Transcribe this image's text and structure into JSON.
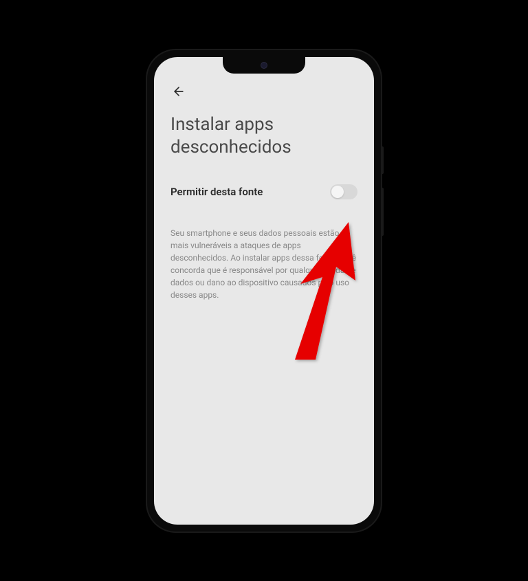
{
  "header": {
    "title": "Instalar apps desconhecidos"
  },
  "setting": {
    "label": "Permitir desta fonte",
    "toggle_state": "off"
  },
  "description": {
    "text": "Seu smartphone e seus dados pessoais estão mais vulneráveis a ataques de apps desconhecidos. Ao instalar apps dessa fonte, você concorda que é responsável por qualquer perda de dados ou dano ao dispositivo causados pelo uso desses apps."
  },
  "annotation": {
    "arrow_color": "#e60000"
  }
}
